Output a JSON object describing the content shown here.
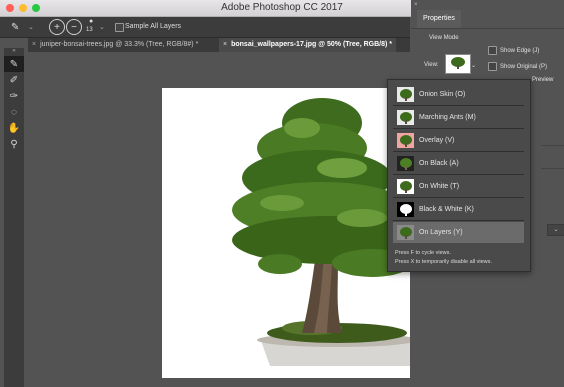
{
  "app": {
    "title": "Adobe Photoshop CC 2017",
    "colors": {
      "traffic_red": "#ff5f57",
      "traffic_yellow": "#febc2e",
      "traffic_green": "#28c840"
    }
  },
  "options": {
    "brush_size": "13",
    "sample_all_layers": "Sample All Layers"
  },
  "tabs": [
    {
      "label": "juniper-bonsai-trees.jpg @ 33.3% (Tree, RGB/8#) *"
    },
    {
      "label": "bonsai_wallpapers-17.jpg @ 50% (Tree, RGB/8) *"
    }
  ],
  "properties": {
    "tab": "Properties",
    "view_mode": "View Mode",
    "view_label": "View:",
    "show_edge": "Show Edge (J)",
    "show_original": "Show Original (P)",
    "preview": "Preview"
  },
  "dropdown": {
    "items": [
      {
        "label": "Onion Skin (O)",
        "icon": "onion-skin-thumb"
      },
      {
        "label": "Marching Ants (M)",
        "icon": "marching-ants-thumb"
      },
      {
        "label": "Overlay (V)",
        "icon": "overlay-thumb"
      },
      {
        "label": "On Black (A)",
        "icon": "on-black-thumb"
      },
      {
        "label": "On White (T)",
        "icon": "on-white-thumb"
      },
      {
        "label": "Black & White (K)",
        "icon": "black-white-thumb"
      },
      {
        "label": "On Layers (Y)",
        "icon": "on-layers-thumb"
      }
    ],
    "hint1": "Press F to cycle views.",
    "hint2": "Press X to temporarily disable all views."
  }
}
